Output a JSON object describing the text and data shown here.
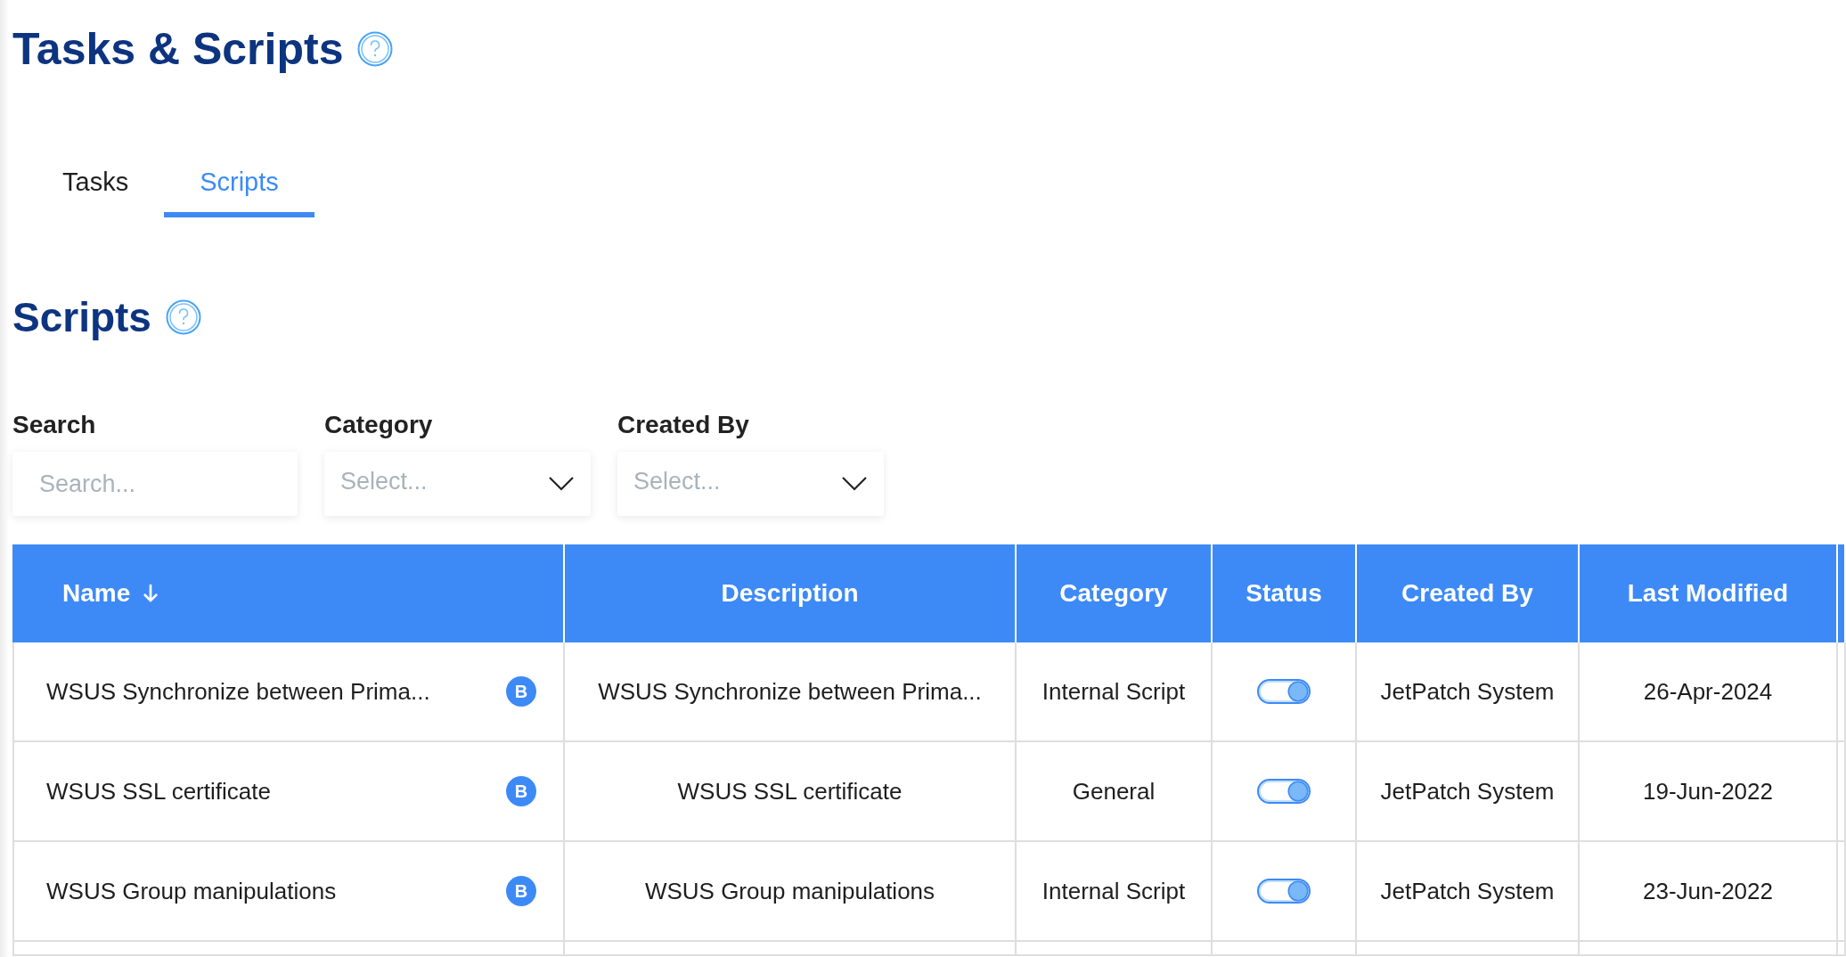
{
  "page_title": "Tasks & Scripts",
  "tabs": [
    {
      "label": "Tasks",
      "selected": false
    },
    {
      "label": "Scripts",
      "selected": true
    }
  ],
  "section_title": "Scripts",
  "filters": [
    {
      "kind": "text",
      "label": "Search",
      "placeholder": "Search..."
    },
    {
      "kind": "select",
      "label": "Category",
      "placeholder": "Select..."
    },
    {
      "kind": "select",
      "label": "Created By",
      "placeholder": "Select..."
    }
  ],
  "table": {
    "columns": [
      {
        "label": "Name",
        "sorted": true
      },
      {
        "label": "Description",
        "sorted": false
      },
      {
        "label": "Category",
        "sorted": false
      },
      {
        "label": "Status",
        "sorted": false
      },
      {
        "label": "Created By",
        "sorted": false
      },
      {
        "label": "Last Modified",
        "sorted": false
      }
    ],
    "rows": [
      {
        "name": "WSUS Synchronize between Prima...",
        "badge": "B",
        "description": "WSUS Synchronize between Prima...",
        "category": "Internal Script",
        "enabled": true,
        "created_by": "JetPatch System",
        "last_modified": "26-Apr-2024"
      },
      {
        "name": "WSUS SSL certificate",
        "badge": "B",
        "description": "WSUS SSL certificate",
        "category": "General",
        "enabled": true,
        "created_by": "JetPatch System",
        "last_modified": "19-Jun-2022"
      },
      {
        "name": "WSUS Group manipulations",
        "badge": "B",
        "description": "WSUS Group manipulations",
        "category": "Internal Script",
        "enabled": true,
        "created_by": "JetPatch System",
        "last_modified": "23-Jun-2022"
      }
    ]
  }
}
